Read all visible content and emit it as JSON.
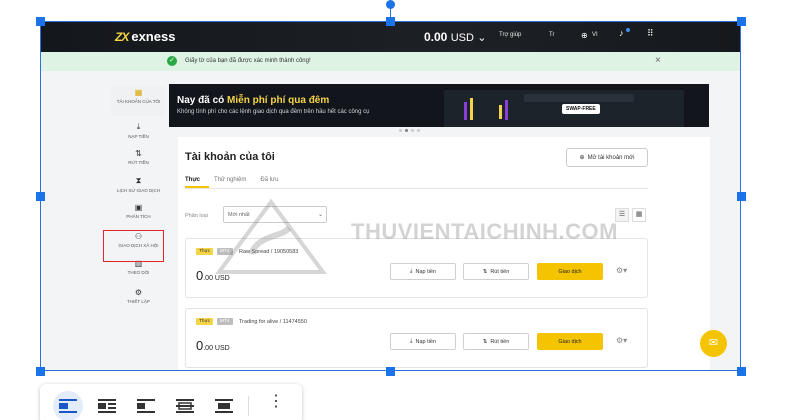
{
  "app": {
    "logo_text": "exness",
    "balance": "0.00",
    "balance_currency": "USD",
    "help_label": "Trợ giúp",
    "notif_label": "Tr",
    "lang_label": "VI",
    "brand_yellow": "#f5c400"
  },
  "banner": {
    "message": "Giấy tờ của bạn đã được xác minh thành công!",
    "icons": [
      "check-circle-icon",
      "close-icon"
    ]
  },
  "sidebar": {
    "items": [
      {
        "label": "TÀI KHOẢN CỦA TÔI",
        "icon": "accounts-icon"
      },
      {
        "label": "NẠP TIỀN",
        "icon": "deposit-icon"
      },
      {
        "label": "RÚT TIỀN",
        "icon": "withdraw-icon"
      },
      {
        "label": "LỊCH SỬ GIAO DỊCH",
        "icon": "history-icon"
      },
      {
        "label": "PHÂN TÍCH",
        "icon": "analytics-icon"
      },
      {
        "label": "GIAO DỊCH XÃ HỘI",
        "icon": "social-trading-icon"
      },
      {
        "label": "THEO DÕI",
        "icon": "monitor-icon"
      },
      {
        "label": "THIẾT LẬP",
        "icon": "settings-icon"
      }
    ]
  },
  "promo": {
    "title_prefix": "Nay đã có ",
    "title_highlight": "Miễn phí phí qua đêm",
    "subtitle": "Không tính phí cho các lệnh giao dịch qua đêm trên hầu hết các công cụ",
    "badge": "SWAP-FREE"
  },
  "accounts_section": {
    "title": "Tài khoản của tôi",
    "open_button": "Mở tài khoản mới",
    "tabs": [
      "Thực",
      "Thử nghiệm",
      "Đã lưu"
    ],
    "sort_label": "Phân loại",
    "sort_value": "Mới nhất"
  },
  "accounts": [
    {
      "type": "Thực",
      "platform": "MT4",
      "name": "Raw Spread / 19050583",
      "balance": "0",
      "balance_decimals": ".00 USD"
    },
    {
      "type": "Thực",
      "platform": "MT4",
      "name": "Trading for alive / 11474550",
      "balance": "0",
      "balance_decimals": ".00 USD"
    }
  ],
  "account_actions": {
    "deposit": "Nạp tiền",
    "withdraw": "Rút tiền",
    "trade": "Giao dịch"
  },
  "watermark": {
    "text": "THUVIENTAICHINH.COM"
  },
  "toolbar": {
    "buttons": [
      "align-inline-icon",
      "wrap-text-icon",
      "break-text-icon",
      "behind-text-icon",
      "in-front-of-text-icon",
      "more-options-icon"
    ]
  }
}
